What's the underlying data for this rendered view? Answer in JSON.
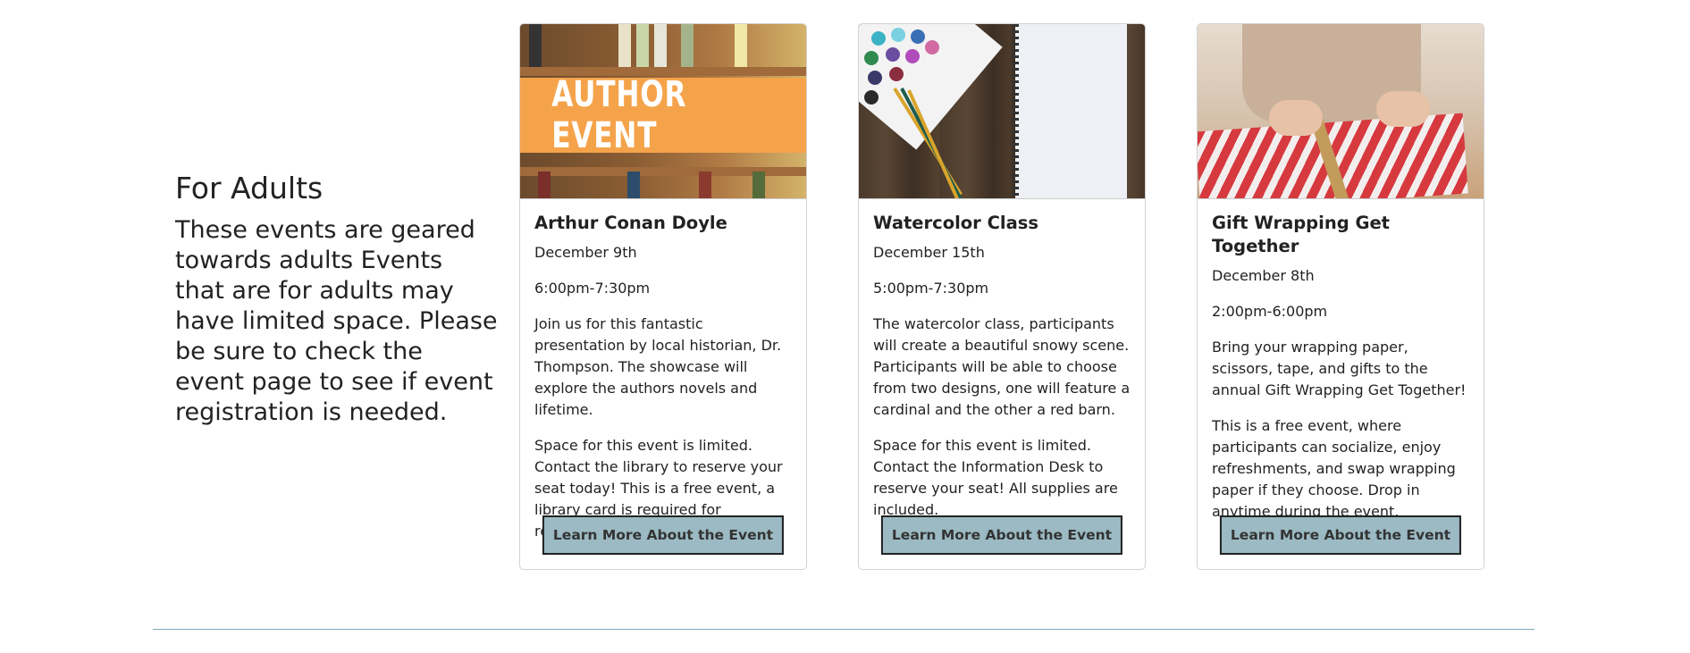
{
  "intro": {
    "heading": "For Adults",
    "text": "These events are geared towards adults Events that are for adults may have limited space. Please be sure to check the event page to see if event registration is needed."
  },
  "events": [
    {
      "image_text": "AUTHOR EVENT",
      "title": "Arthur Conan Doyle",
      "date": "December 9th",
      "time": "6:00pm-7:30pm",
      "paragraphs": [
        "Join us for this fantastic presentation by local historian, Dr. Thompson. The showcase will explore the authors novels and lifetime.",
        "Space for this event is limited. Contact the library to reserve your seat today! This is a free event, a library card is required for registration."
      ],
      "button": "Learn More About the Event"
    },
    {
      "title": "Watercolor Class",
      "date": "December 15th",
      "time": "5:00pm-7:30pm",
      "paragraphs": [
        "The watercolor class, participants will create a beautiful snowy scene. Participants will be able to choose from two designs, one will feature a cardinal and the other a red barn.",
        "Space for this event is limited. Contact the Information Desk to reserve your seat! All supplies are included."
      ],
      "button": "Learn More About the Event"
    },
    {
      "title": "Gift Wrapping Get Together",
      "date": "December 8th",
      "time": "2:00pm-6:00pm",
      "paragraphs": [
        "Bring your wrapping paper, scissors, tape, and gifts to the annual Gift Wrapping Get Together!",
        "This is a free event, where participants can socialize, enjoy refreshments, and swap wrapping paper if they choose. Drop in anytime during the event."
      ],
      "button": "Learn More About the Event"
    }
  ],
  "colors": {
    "button_bg": "#9bbac3",
    "divider": "#7fa7b6",
    "banner_orange": "#f5a34b"
  }
}
